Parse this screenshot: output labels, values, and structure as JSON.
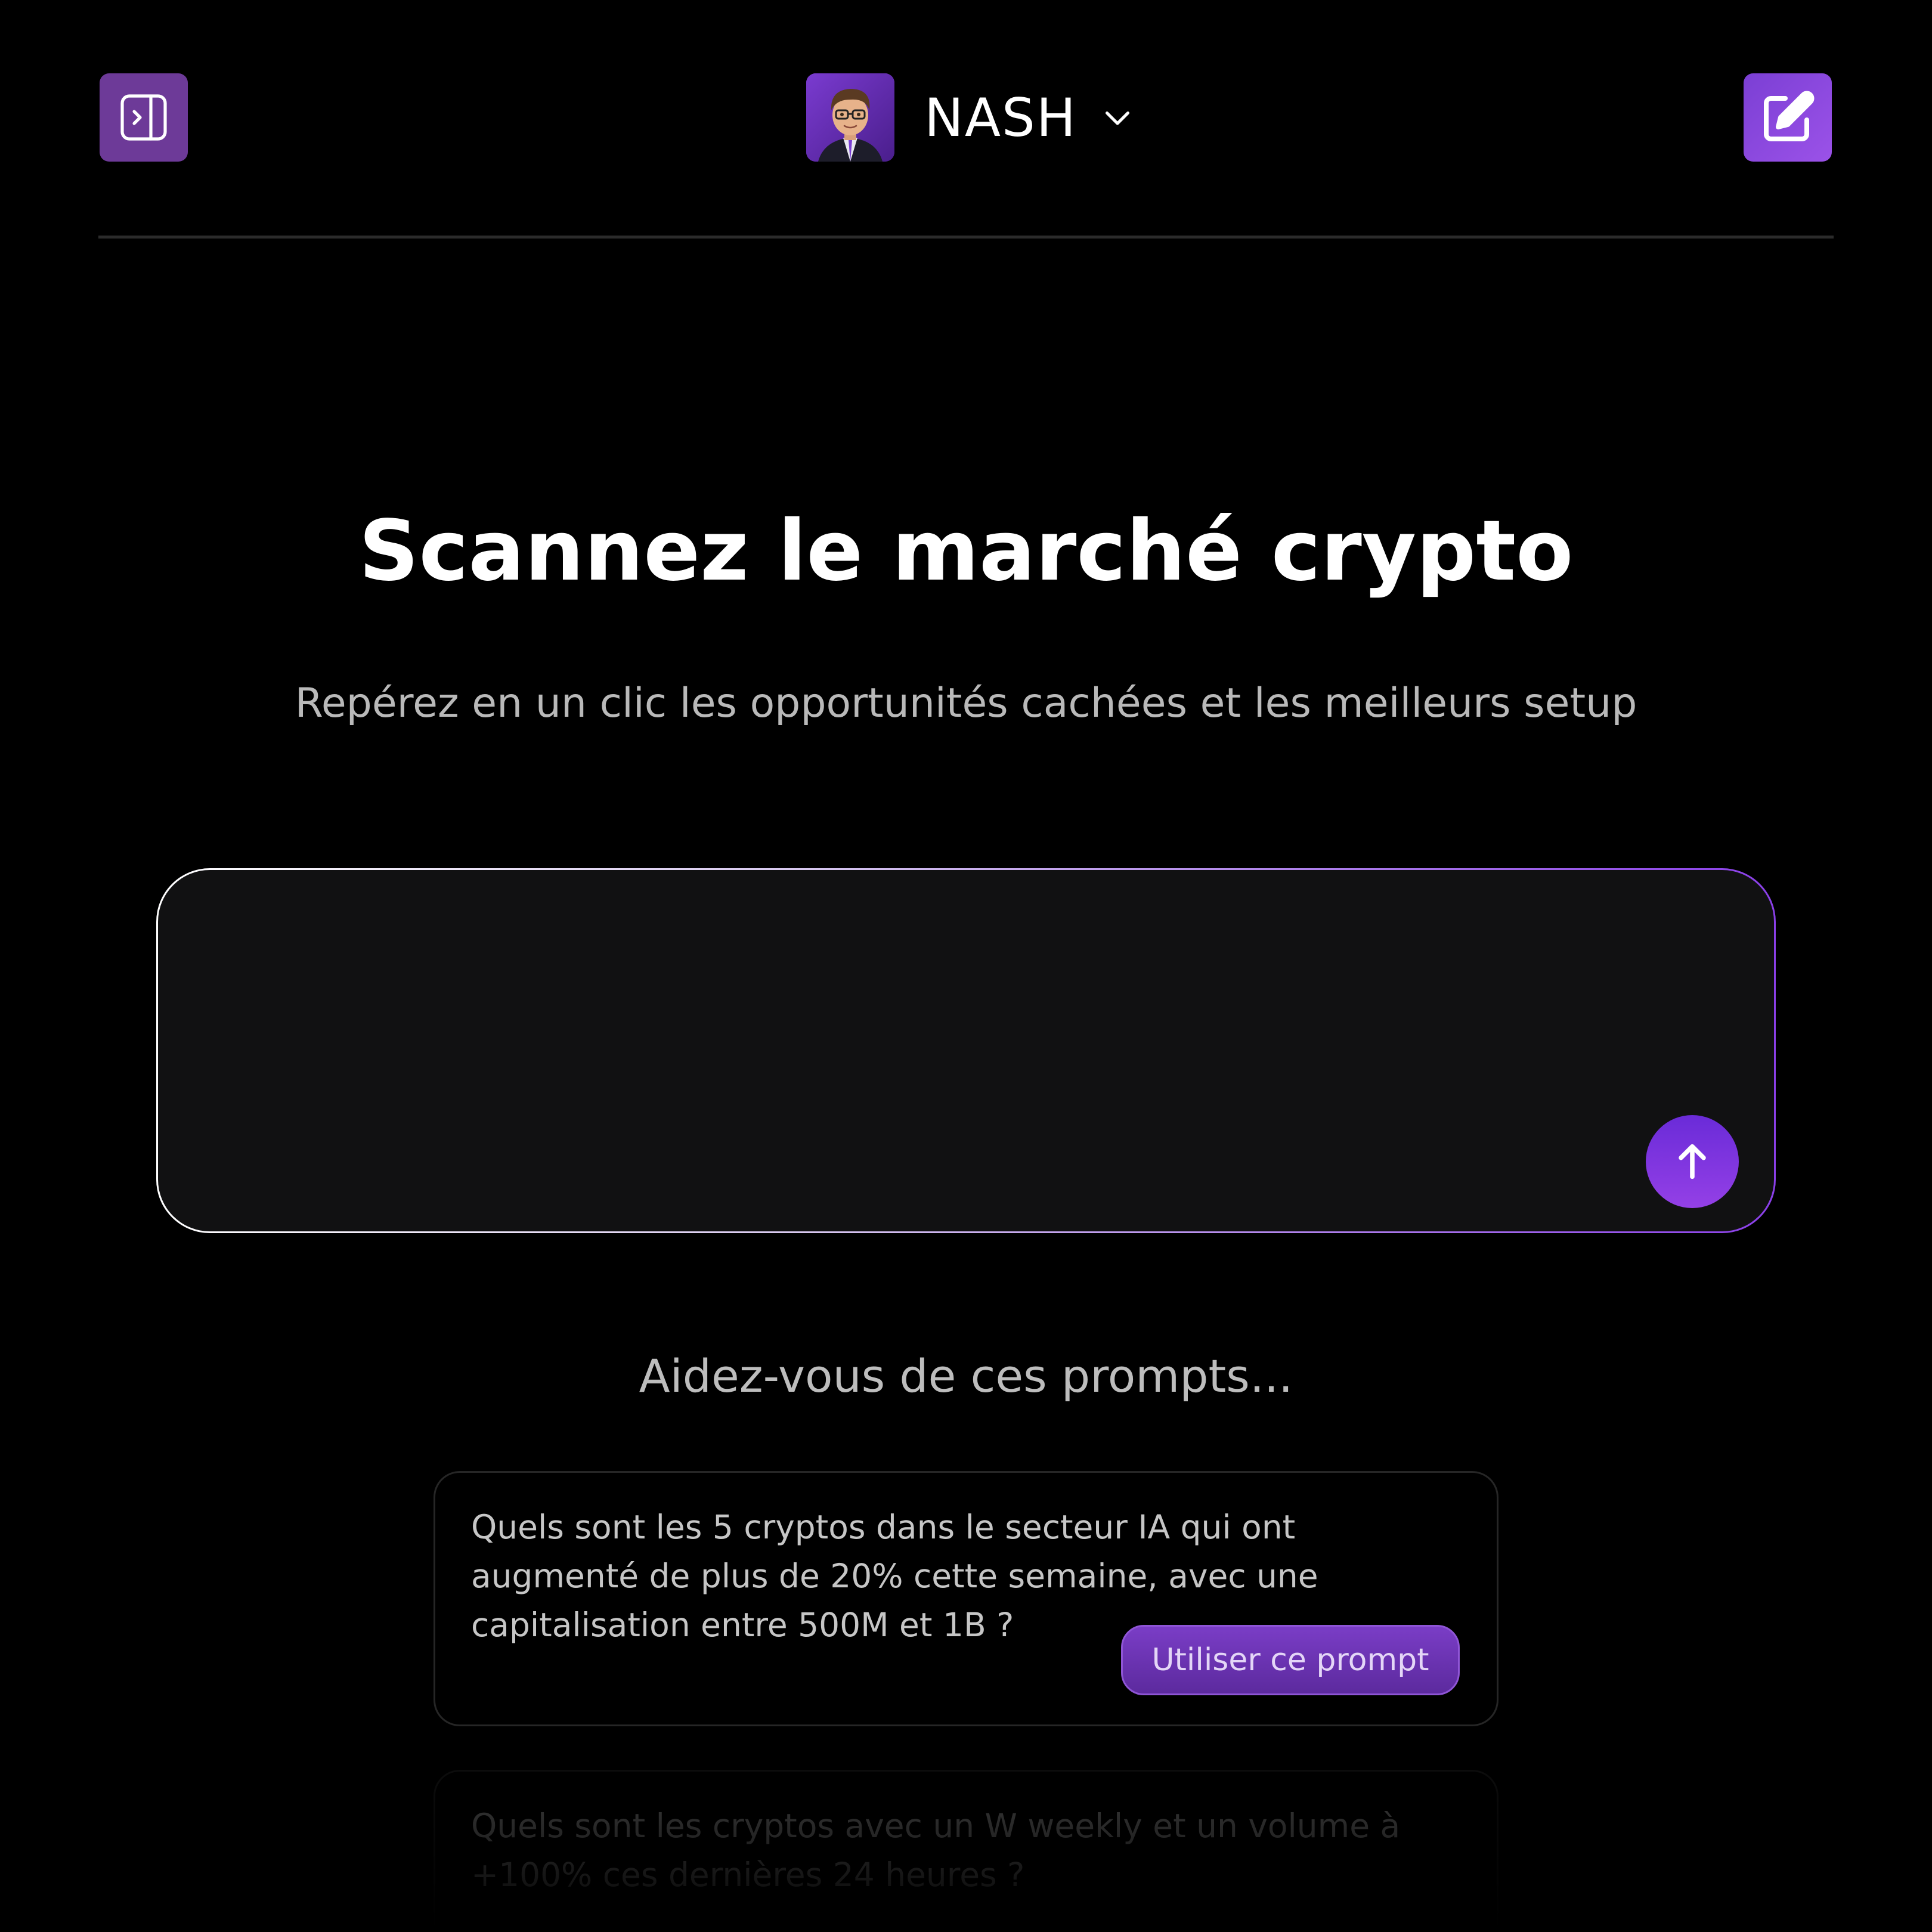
{
  "header": {
    "bot_name": "NASH",
    "icons": {
      "sidebar_toggle": "sidebar-toggle-icon",
      "new_chat": "edit-icon",
      "dropdown": "chevron-down-icon",
      "avatar": "avatar"
    }
  },
  "hero": {
    "title": "Scannez le marché crypto",
    "subtitle": "Repérez en un clic les opportunités cachées et les meilleurs setup"
  },
  "composer": {
    "value": "",
    "send_icon": "arrow-up-icon"
  },
  "prompts": {
    "heading": "Aidez-vous de ces prompts...",
    "use_label": "Utiliser ce prompt",
    "items": [
      {
        "text": "Quels sont les 5 cryptos dans le secteur IA qui ont augmenté de plus de 20% cette semaine, avec une capitalisation entre 500M et 1B ?"
      },
      {
        "text": "Quels sont les cryptos avec un W weekly et un volume à +100% ces dernières 24 heures ?"
      }
    ]
  },
  "colors": {
    "background": "#000000",
    "accent": "#7b3fd4",
    "button": "#6d3a98"
  }
}
